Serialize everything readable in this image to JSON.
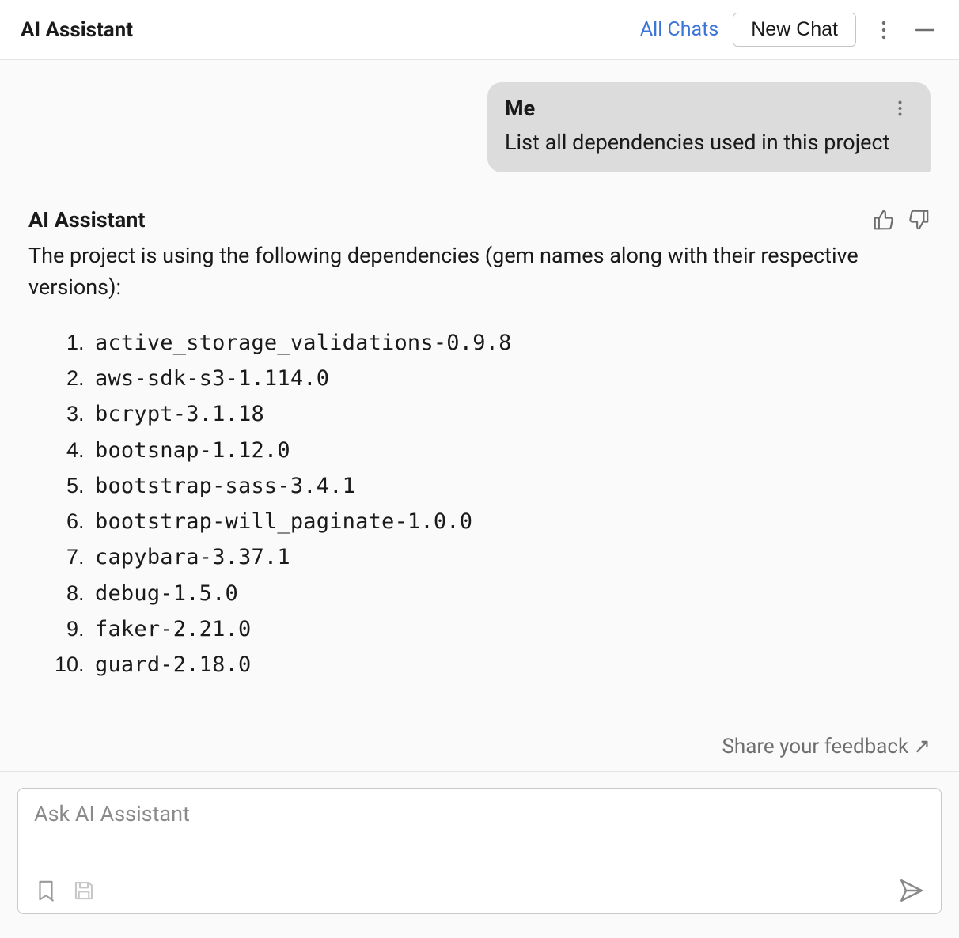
{
  "header": {
    "title": "AI Assistant",
    "all_chats": "All Chats",
    "new_chat": "New Chat"
  },
  "user_message": {
    "author": "Me",
    "text": "List all dependencies used in this project"
  },
  "assistant_message": {
    "author": "AI Assistant",
    "intro": "The project is using the following dependencies (gem names along with their respective versions):",
    "dependencies": [
      "active_storage_validations-0.9.8",
      "aws-sdk-s3-1.114.0",
      "bcrypt-3.1.18",
      "bootsnap-1.12.0",
      "bootstrap-sass-3.4.1",
      "bootstrap-will_paginate-1.0.0",
      "capybara-3.37.1",
      "debug-1.5.0",
      "faker-2.21.0",
      "guard-2.18.0"
    ]
  },
  "feedback_link": "Share your feedback",
  "input": {
    "placeholder": "Ask AI Assistant"
  }
}
